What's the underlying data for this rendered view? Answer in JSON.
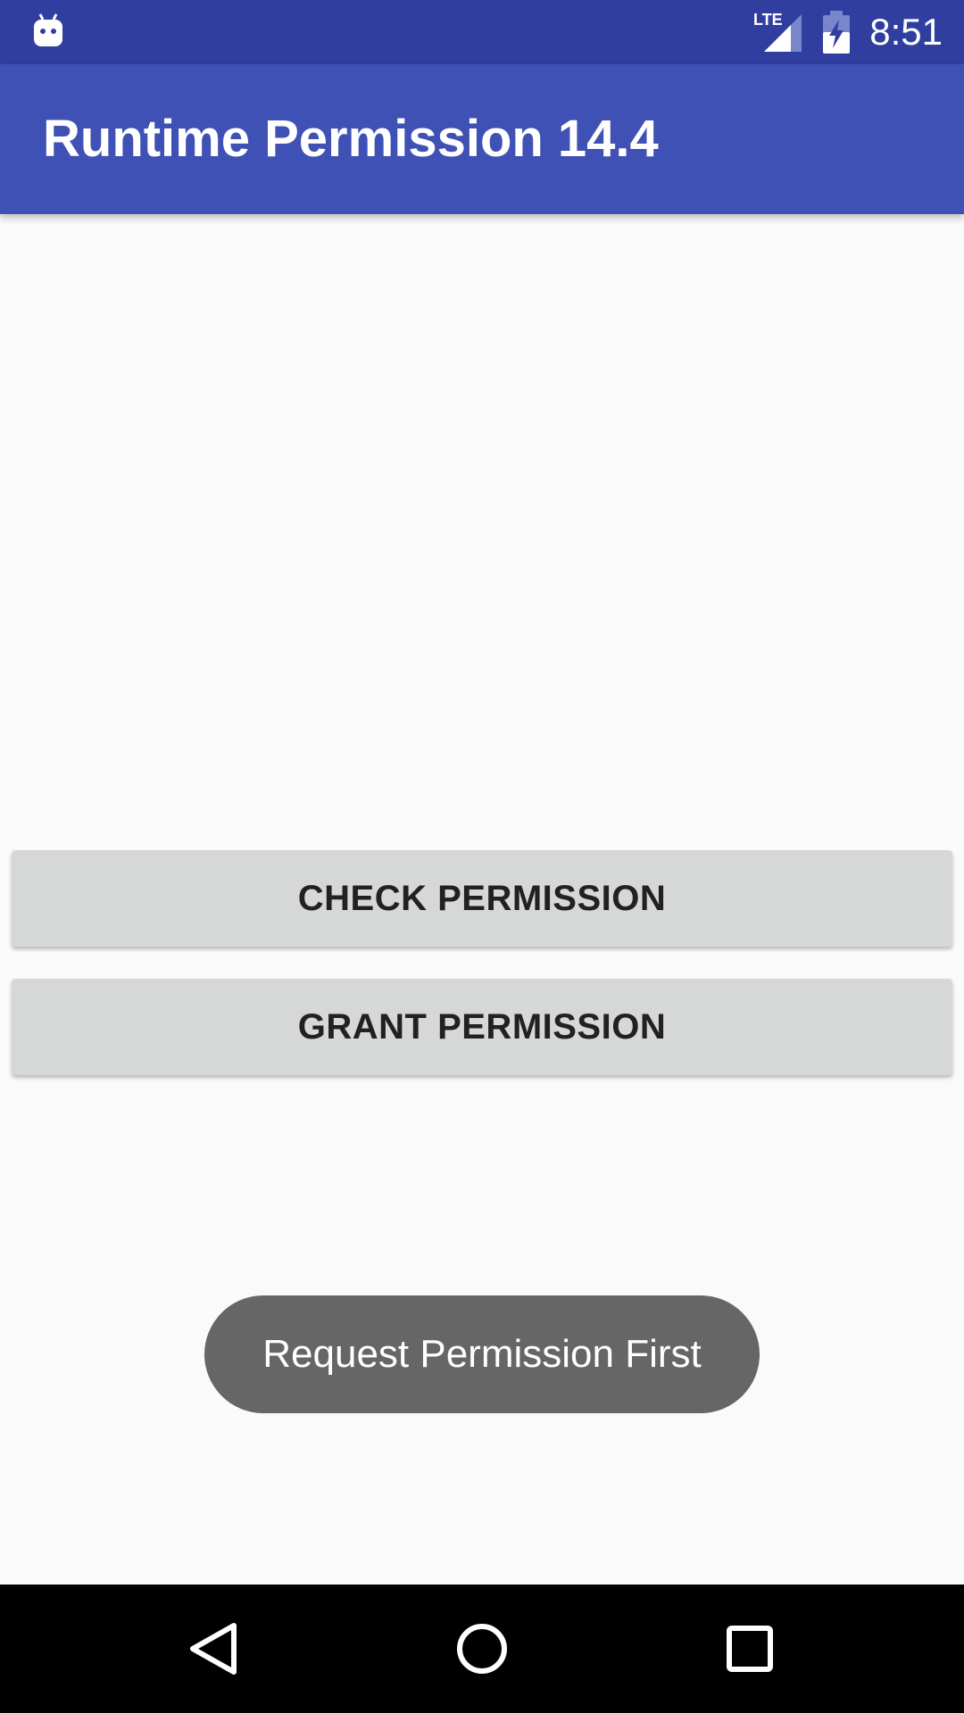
{
  "status_bar": {
    "time": "8:51",
    "network_label": "LTE",
    "icons": [
      "android-notification-icon",
      "lte-signal-icon",
      "battery-charging-icon"
    ]
  },
  "app_bar": {
    "title": "Runtime Permission 14.4",
    "color": "#3f51b5",
    "status_color": "#303f9f"
  },
  "buttons": {
    "check": "CHECK PERMISSION",
    "grant": "GRANT PERMISSION"
  },
  "toast": {
    "message": "Request Permission First"
  },
  "nav_bar": {
    "icons": [
      "back-icon",
      "home-icon",
      "recent-apps-icon"
    ]
  }
}
